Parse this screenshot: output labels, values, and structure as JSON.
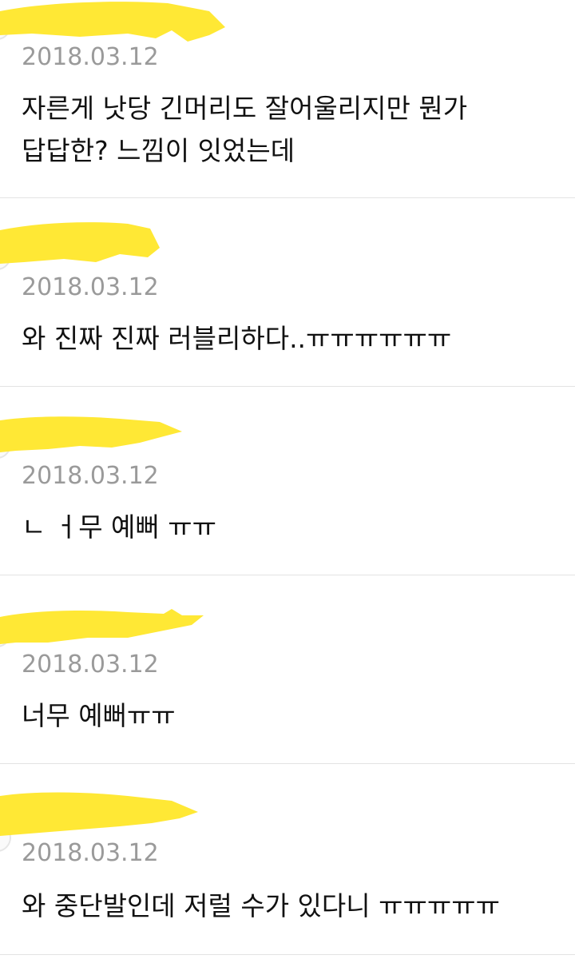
{
  "comments": [
    {
      "author_hidden": true,
      "date": "2018.03.12",
      "text": "자른게 낫당 긴머리도 잘어울리지만 뭔가\n답답한? 느낌이 잇었는데"
    },
    {
      "author_hidden": true,
      "date": "2018.03.12",
      "text": "와 진짜 진짜 러블리하다..ㅠㅠㅠㅠㅠㅠ"
    },
    {
      "author_hidden": true,
      "date": "2018.03.12",
      "text": "ㄴ ㅓ무 예뻐 ㅠㅠ"
    },
    {
      "author_hidden": true,
      "date": "2018.03.12",
      "text": "너무 예뻐ㅠㅠ"
    },
    {
      "author_hidden": true,
      "date": "2018.03.12",
      "text": "와 중단발인데 저럴 수가 있다니 ㅠㅠㅠㅠㅠ"
    }
  ],
  "colors": {
    "background": "#ffffff",
    "divider": "#e3e3e3",
    "date_text": "#9a9a9a",
    "body_text": "#111111",
    "redaction_highlight": "#ffe835"
  }
}
